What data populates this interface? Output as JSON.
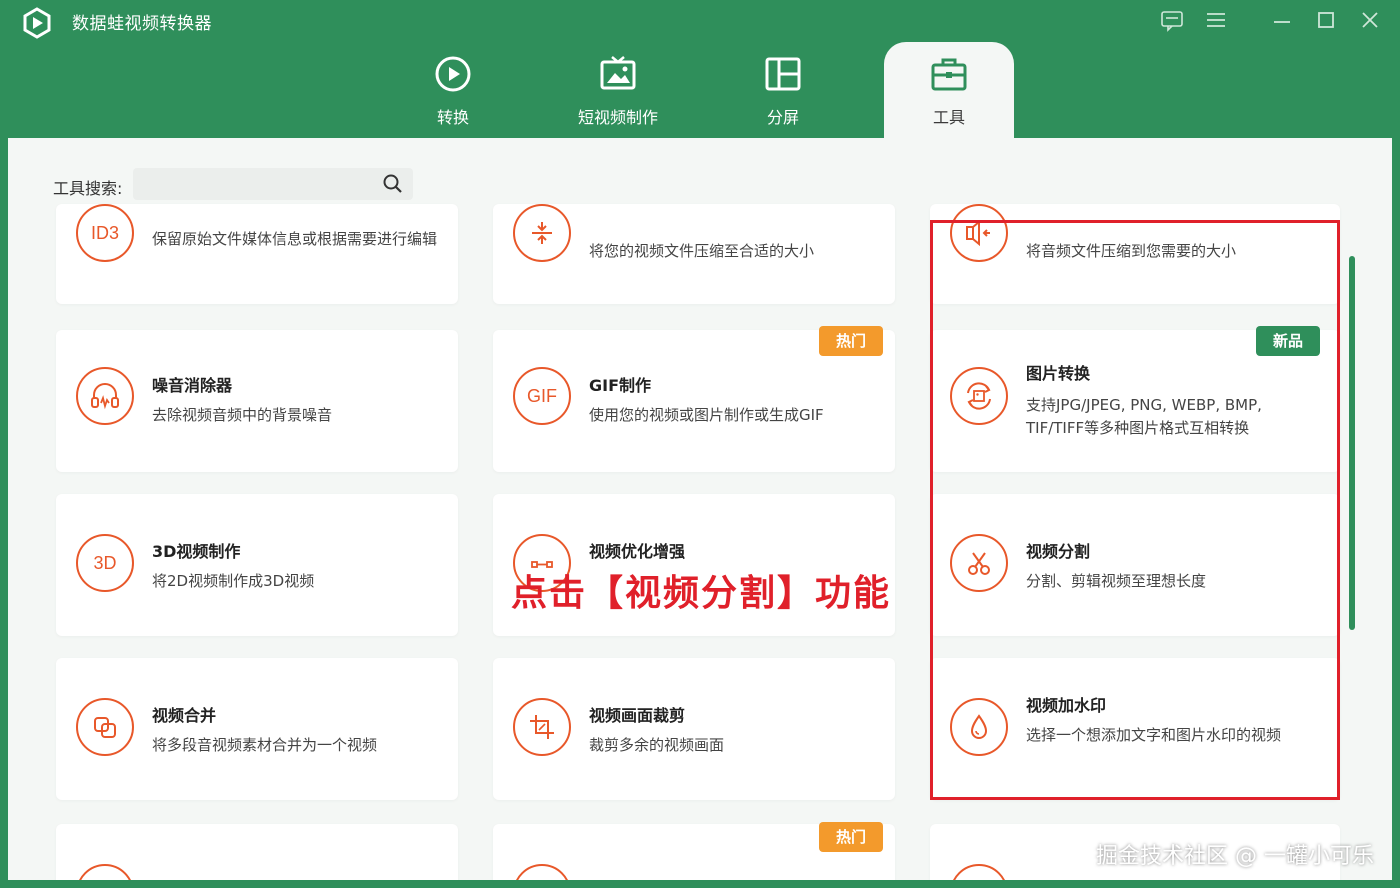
{
  "app": {
    "title": "数据蛙视频转换器",
    "accent_color": "#2f8f5b",
    "icon_color": "#e8582a"
  },
  "window_controls": [
    {
      "name": "feedback-icon",
      "glyph": "▢"
    },
    {
      "name": "menu-icon",
      "glyph": "☰"
    },
    {
      "name": "minimize-icon",
      "glyph": "—"
    },
    {
      "name": "maximize-icon",
      "glyph": "☐"
    },
    {
      "name": "close-icon",
      "glyph": "✕"
    }
  ],
  "tabs": [
    {
      "label": "转换",
      "icon": "convert-icon",
      "active": false
    },
    {
      "label": "短视频制作",
      "icon": "short-video-icon",
      "active": false
    },
    {
      "label": "分屏",
      "icon": "split-screen-icon",
      "active": false
    },
    {
      "label": "工具",
      "icon": "toolbox-icon",
      "active": true
    }
  ],
  "search": {
    "label": "工具搜索:",
    "value": "",
    "placeholder": ""
  },
  "tools": [
    {
      "title": "",
      "desc": "保留原始文件媒体信息或根据需要进行编辑",
      "icon_text": "ID3",
      "icon": "id3-icon"
    },
    {
      "title": "",
      "desc": "将您的视频文件压缩至合适的大小",
      "icon_text": "",
      "icon": "video-compress-icon"
    },
    {
      "title": "",
      "desc": "将音频文件压缩到您需要的大小",
      "icon_text": "",
      "icon": "audio-compress-icon"
    },
    {
      "title": "噪音消除器",
      "desc": "去除视频音频中的背景噪音",
      "icon_text": "",
      "icon": "headphones-icon"
    },
    {
      "title": "GIF制作",
      "desc": "使用您的视频或图片制作或生成GIF",
      "icon_text": "GIF",
      "icon": "gif-icon",
      "badge": "热门"
    },
    {
      "title": "图片转换",
      "desc": "支持JPG/JPEG, PNG, WEBP, BMP, TIF/TIFF等多种图片格式互相转换",
      "icon_text": "",
      "icon": "image-convert-icon",
      "badge": "新品"
    },
    {
      "title": "3D视频制作",
      "desc": "将2D视频制作成3D视频",
      "icon_text": "3D",
      "icon": "3d-icon"
    },
    {
      "title": "视频优化增强",
      "desc": "",
      "icon_text": "",
      "icon": "enhance-icon"
    },
    {
      "title": "视频分割",
      "desc": "分割、剪辑视频至理想长度",
      "icon_text": "",
      "icon": "scissors-icon"
    },
    {
      "title": "视频合并",
      "desc": "将多段音视频素材合并为一个视频",
      "icon_text": "",
      "icon": "merge-icon"
    },
    {
      "title": "视频画面裁剪",
      "desc": "裁剪多余的视频画面",
      "icon_text": "",
      "icon": "crop-icon"
    },
    {
      "title": "视频加水印",
      "desc": "选择一个想添加文字和图片水印的视频",
      "icon_text": "",
      "icon": "watermark-drop-icon"
    }
  ],
  "bottom_row_badge": "热门",
  "annotation": "点击【视频分割】功能",
  "watermark": "掘金技术社区 @ 一罐小可乐"
}
